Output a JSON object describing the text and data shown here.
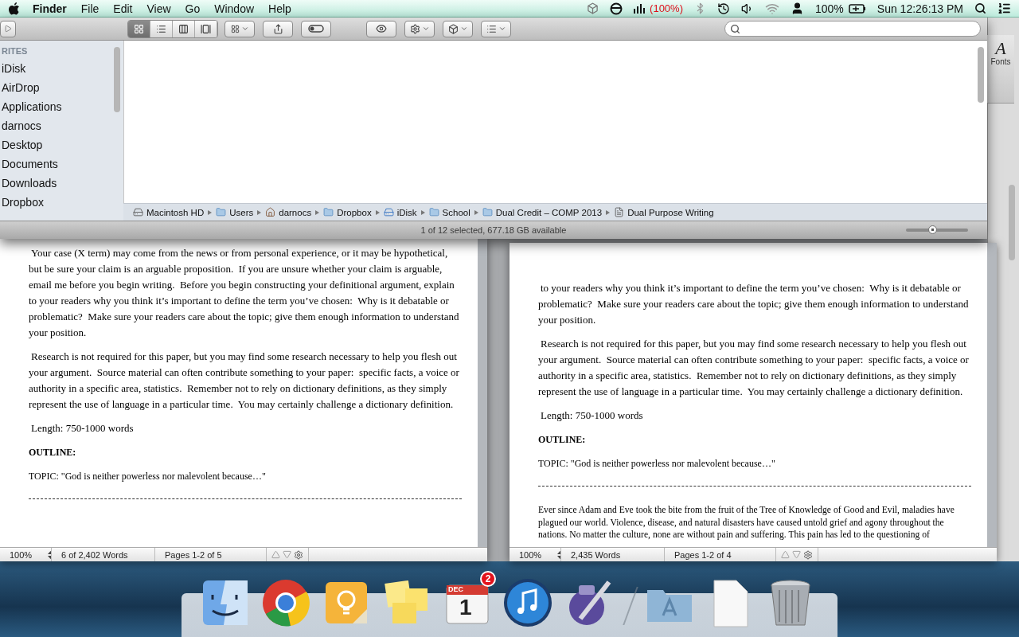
{
  "menu_bar": {
    "app_name": "Finder",
    "menus": [
      "File",
      "Edit",
      "View",
      "Go",
      "Window",
      "Help"
    ],
    "signal_reading": "(100%)",
    "battery_reading": "100%",
    "clock": "Sun 12:26:13 PM"
  },
  "finder": {
    "sidebar": {
      "header": "RITES",
      "items": [
        {
          "label": "iDisk",
          "selected": false
        },
        {
          "label": "AirDrop",
          "selected": false
        },
        {
          "label": "Applications",
          "selected": false
        },
        {
          "label": "darnocs",
          "selected": false
        },
        {
          "label": "Desktop",
          "selected": false
        },
        {
          "label": "Documents",
          "selected": false
        },
        {
          "label": "Downloads",
          "selected": false
        },
        {
          "label": "Dropbox",
          "selected": false
        }
      ]
    },
    "view_buttons": [
      {
        "kind": "icons",
        "selected": true
      },
      {
        "kind": "list",
        "selected": false
      },
      {
        "kind": "columns",
        "selected": false
      },
      {
        "kind": "coverflow",
        "selected": false
      }
    ],
    "path": [
      {
        "kind": "disk",
        "label": "Macintosh HD"
      },
      {
        "kind": "folder",
        "label": "Users"
      },
      {
        "kind": "home",
        "label": "darnocs"
      },
      {
        "kind": "folder",
        "label": "Dropbox"
      },
      {
        "kind": "disk-image",
        "label": "iDisk"
      },
      {
        "kind": "folder",
        "label": "School"
      },
      {
        "kind": "folder",
        "label": "Dual Credit – COMP 2013"
      },
      {
        "kind": "document",
        "label": "Dual Purpose Writing"
      }
    ],
    "status": "1 of 12 selected, 677.18 GB available",
    "icon_size": {
      "level": 0.42
    }
  },
  "fonts_panel": {
    "glyph": "A",
    "label": "Fonts"
  },
  "documents": [
    {
      "blocks": [
        {
          "kind": "body",
          "text": "Your case (X term) may come from the news or from personal experience, or it may be hypothetical, but be sure your claim is an arguable proposition.  If you are unsure whether your claim is arguable, email me before you begin writing.  Before you begin constructing your definitional argument, explain to your readers why you think it’s important to define the term you’ve chosen:  Why is it debatable or problematic?  Make sure your readers care about the topic; give them enough information to understand your position."
        },
        {
          "kind": "body",
          "text": "Research is not required for this paper, but you may find some research necessary to help you flesh out your argument.  Source material can often contribute something to your paper:  specific facts, a voice or authority in a specific area, statistics.  Remember not to rely on dictionary definitions, as they simply represent the use of language in a particular time.  You may certainly challenge a dictionary definition."
        },
        {
          "kind": "body",
          "text": "Length: 750-1000 words"
        },
        {
          "kind": "heading",
          "text": "OUTLINE:"
        },
        {
          "kind": "topic",
          "text": "TOPIC: \"God is neither powerless nor malevolent because…\""
        },
        {
          "kind": "rule"
        }
      ],
      "status": {
        "zoom": "100%",
        "words": "6 of 2,402 Words",
        "pages": "Pages 1-2 of 5"
      }
    },
    {
      "blocks": [
        {
          "kind": "body",
          "text": "to your readers why you think it’s important to define the term you’ve chosen:  Why is it debatable or problematic?  Make sure your readers care about the topic; give them enough information to understand your position."
        },
        {
          "kind": "body",
          "text": "Research is not required for this paper, but you may find some research necessary to help you flesh out your argument.  Source material can often contribute something to your paper:  specific facts, a voice or authority in a specific area, statistics.  Remember not to rely on dictionary definitions, as they simply represent the use of language in a particular time.  You may certainly challenge a dictionary definition."
        },
        {
          "kind": "body",
          "text": "Length: 750-1000 words"
        },
        {
          "kind": "heading",
          "text": "OUTLINE:"
        },
        {
          "kind": "topic",
          "text": "TOPIC: \"God is neither powerless nor malevolent because…\""
        },
        {
          "kind": "rule"
        },
        {
          "kind": "essay",
          "text": "Ever since Adam and Eve took the bite from the fruit of the Tree of Knowledge of Good and Evil, maladies have plagued our world. Violence, disease, and natural disasters have caused untold grief and agony throughout the nations. No matter the culture, none are without pain and suffering. This pain has led to the questioning of"
        }
      ],
      "status": {
        "zoom": "100%",
        "words": "2,435 Words",
        "pages": "Pages 1-2 of 4"
      }
    }
  ],
  "dock": {
    "items": [
      {
        "kind": "finder"
      },
      {
        "kind": "browser"
      },
      {
        "kind": "lightbulb"
      },
      {
        "kind": "notes"
      },
      {
        "kind": "calendar",
        "month": "DEC",
        "day": "1",
        "badge": "2"
      },
      {
        "kind": "music"
      },
      {
        "kind": "pen"
      },
      {
        "kind": "separator"
      },
      {
        "kind": "apps-folder"
      },
      {
        "kind": "blank-document"
      },
      {
        "kind": "trash"
      }
    ]
  }
}
